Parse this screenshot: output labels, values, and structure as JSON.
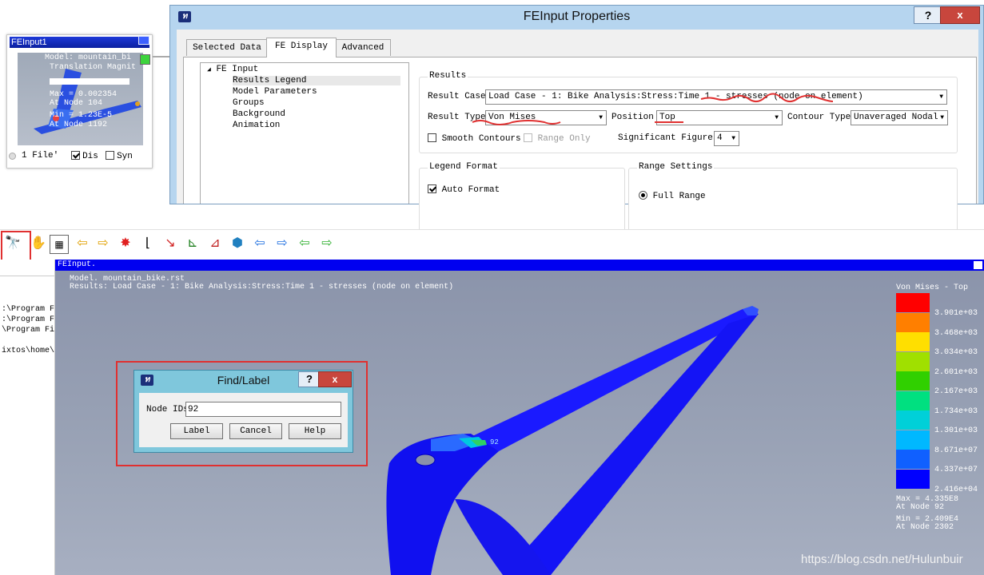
{
  "module": {
    "title": "FEInput1",
    "thumb_lines": [
      "Model:     mountain_bi",
      "Translation Magnit",
      "Max = 0.002354",
      "At Node 104",
      "Min = 1.23E-5",
      "At Node 1192"
    ],
    "files_label": "1 File'",
    "disp_label": "Dis",
    "sync_label": "Syn",
    "disp_checked": true,
    "sync_checked": false
  },
  "props": {
    "title": "FEInput Properties",
    "help_label": "?",
    "close_label": "x",
    "tabs": [
      "Selected Data",
      "FE Display",
      "Advanced"
    ],
    "active_tab": "FE Display",
    "tree": {
      "root": "FE Input",
      "items": [
        "Results Legend",
        "Model Parameters",
        "Groups",
        "Background",
        "Animation"
      ],
      "selected": "Results Legend"
    },
    "results": {
      "group_label": "Results",
      "result_case_label": "Result Case",
      "result_case_value": "Load Case - 1: Bike Analysis:Stress:Time 1 - stresses (node on element)",
      "result_type_label": "Result Type",
      "result_type_value": "Von Mises",
      "position_label": "Position",
      "position_value": "Top",
      "contour_type_label": "Contour Type",
      "contour_type_value": "Unaveraged Nodal",
      "smooth_contours_label": "Smooth Contours",
      "range_only_label": "Range Only",
      "significant_figures_label": "Significant Figures",
      "significant_figures_value": "4"
    },
    "legend_format": {
      "group_label": "Legend Format",
      "auto_format_label": "Auto Format",
      "auto_format_checked": true
    },
    "range_settings": {
      "group_label": "Range Settings",
      "full_range_label": "Full Range"
    }
  },
  "left_pane": {
    "lines": [
      ":\\Program F",
      ":\\Program F",
      "\\Program Fi",
      "ixtos\\home\\l"
    ]
  },
  "viewport": {
    "title": "FEInput.",
    "model_line": "Model.   mountain_bike.rst",
    "results_line": "Results:  Load Case - 1: Bike Analysis:Stress:Time 1 - stresses (node on element)",
    "legend_title": "Von Mises - Top",
    "legend_colors": [
      "#ff0000",
      "#ff7f00",
      "#ffdf00",
      "#a0e000",
      "#30d000",
      "#00e080",
      "#00d0d8",
      "#00b8ff",
      "#1060ff",
      "#0000ff"
    ],
    "legend_values": [
      "3.901e+03",
      "3.468e+03",
      "3.034e+03",
      "2.601e+03",
      "2.167e+03",
      "1.734e+03",
      "1.301e+03",
      "8.671e+07",
      "4.337e+07",
      "2.416e+04"
    ],
    "max_line": "Max = 4.335E8",
    "max_node": "At Node 92",
    "min_line": "Min = 2.409E4",
    "min_node": "At Node 2302",
    "node_marker": "92"
  },
  "find_dialog": {
    "title": "Find/Label",
    "help_label": "?",
    "close_label": "x",
    "node_ids_label": "Node IDs",
    "node_ids_value": "92",
    "label_button": "Label",
    "cancel_button": "Cancel",
    "help_button": "Help"
  },
  "watermark": "https://blog.csdn.net/Hulunbuir",
  "colors": {
    "accent_red": "#e03030",
    "viewport_title": "#0000f0",
    "dialog_frame": "#b6d5ef",
    "find_frame": "#7fc7dc"
  }
}
